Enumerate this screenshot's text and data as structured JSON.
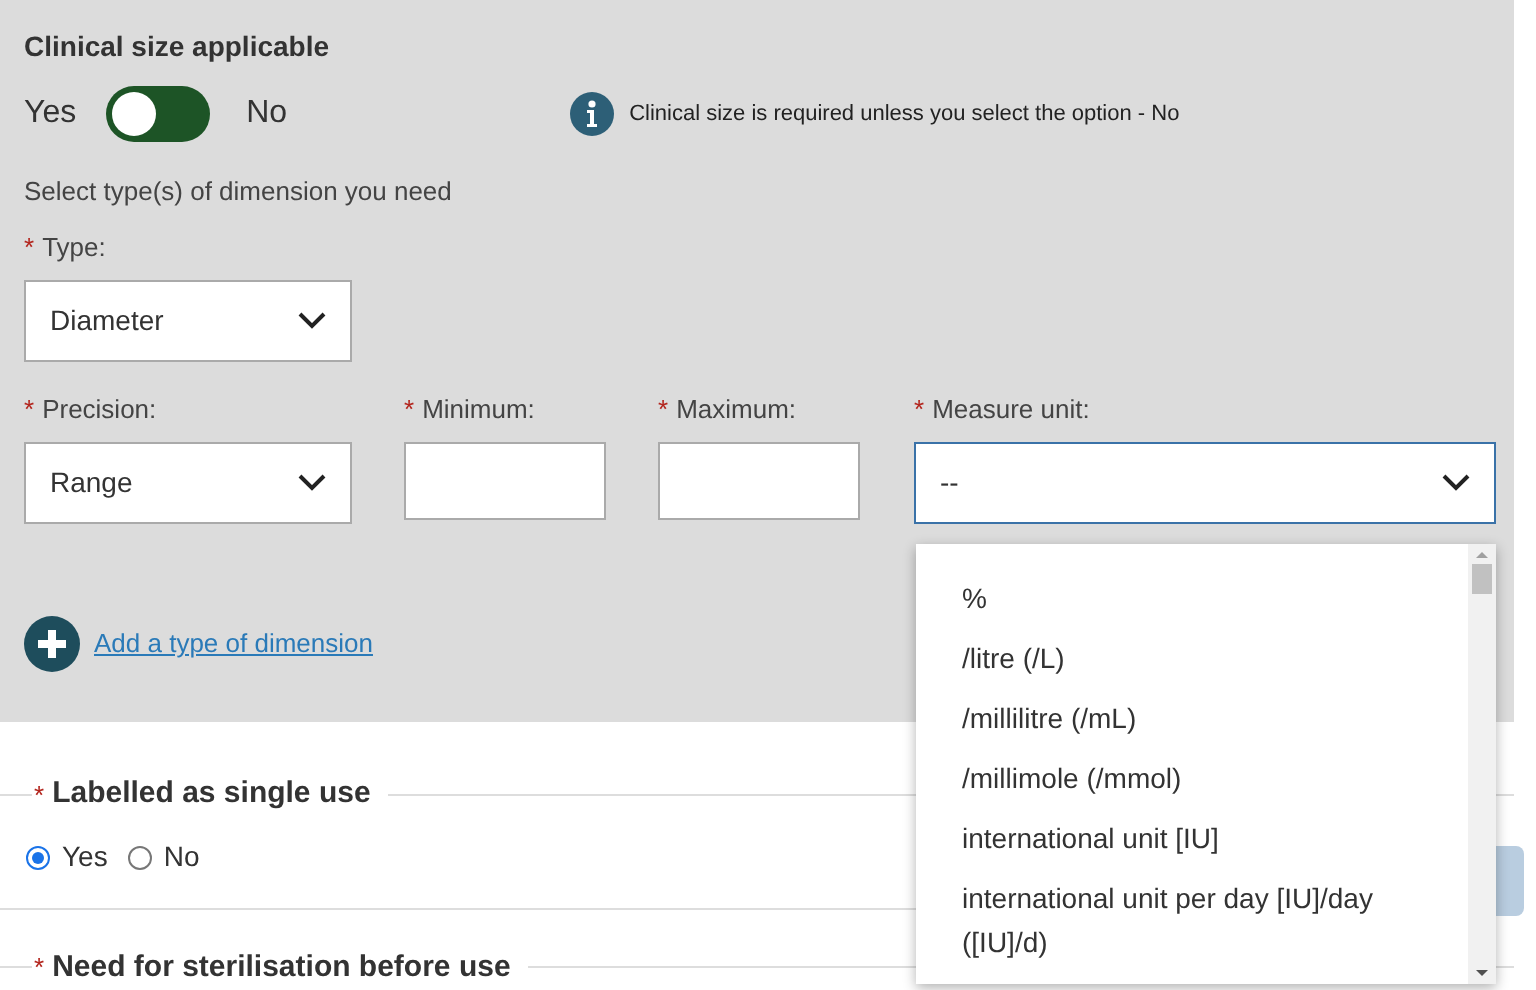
{
  "clinical_size": {
    "title": "Clinical size applicable",
    "toggle": {
      "yes_label": "Yes",
      "no_label": "No",
      "on": false
    },
    "info": "Clinical size is required unless you select the option - No",
    "instruction": "Select type(s) of dimension you need",
    "type": {
      "required_mark": "*",
      "label": "Type:",
      "value": "Diameter"
    },
    "precision": {
      "required_mark": "*",
      "label": "Precision:",
      "value": "Range"
    },
    "minimum": {
      "required_mark": "*",
      "label": "Minimum:"
    },
    "maximum": {
      "required_mark": "*",
      "label": "Maximum:"
    },
    "measure_unit": {
      "required_mark": "*",
      "label": "Measure unit:",
      "value": "--",
      "expanded": true,
      "options": [
        "%",
        "/litre (/L)",
        "/millilitre (/mL)",
        "/millimole (/mmol)",
        "international unit [IU]",
        "international unit per day [IU]/day ([IU]/d)"
      ]
    },
    "add_link": "Add a type of dimension"
  },
  "single_use": {
    "required_mark": "*",
    "title": "Labelled as single use",
    "options": [
      {
        "label": "Yes",
        "selected": true
      },
      {
        "label": "No",
        "selected": false
      }
    ]
  },
  "sterilisation": {
    "required_mark": "*",
    "title": "Need for sterilisation before use"
  }
}
